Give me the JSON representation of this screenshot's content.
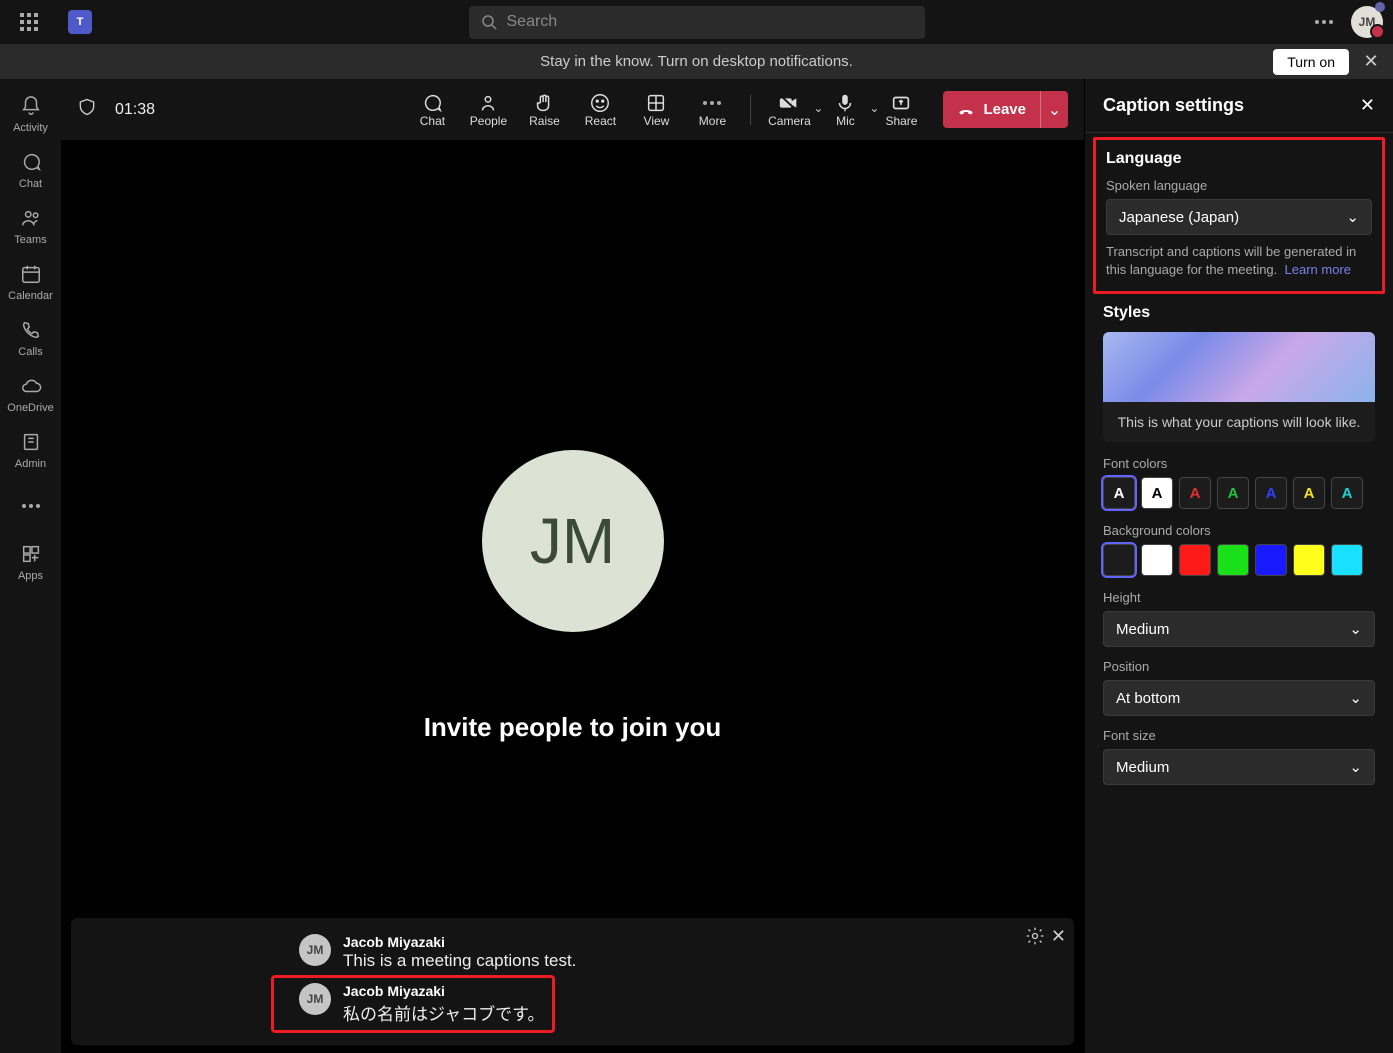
{
  "titlebar": {
    "search_placeholder": "Search",
    "avatar_initials": "JM"
  },
  "notification": {
    "text": "Stay in the know. Turn on desktop notifications.",
    "button": "Turn on"
  },
  "rail": [
    {
      "label": "Activity"
    },
    {
      "label": "Chat"
    },
    {
      "label": "Teams"
    },
    {
      "label": "Calendar"
    },
    {
      "label": "Calls"
    },
    {
      "label": "OneDrive"
    },
    {
      "label": "Admin"
    },
    {
      "label": ""
    },
    {
      "label": "Apps"
    }
  ],
  "meeting": {
    "timer": "01:38",
    "buttons": [
      "Chat",
      "People",
      "Raise",
      "React",
      "View",
      "More",
      "Camera",
      "Mic",
      "Share"
    ],
    "leave": "Leave",
    "avatar_initials": "JM",
    "invite": "Invite people to join you"
  },
  "captions": [
    {
      "initials": "JM",
      "name": "Jacob Miyazaki",
      "text": "This is a meeting captions test."
    },
    {
      "initials": "JM",
      "name": "Jacob Miyazaki",
      "text": "私の名前はジャコブです。"
    }
  ],
  "panel": {
    "title": "Caption settings",
    "language_section": "Language",
    "spoken_label": "Spoken language",
    "spoken_value": "Japanese (Japan)",
    "help": "Transcript and captions will be generated in this language for the meeting.",
    "learn_more": "Learn more",
    "styles_section": "Styles",
    "preview_text": "This is what your captions will look like.",
    "font_colors_label": "Font colors",
    "bg_colors_label": "Background colors",
    "height_label": "Height",
    "height_value": "Medium",
    "position_label": "Position",
    "position_value": "At bottom",
    "fontsize_label": "Font size",
    "fontsize_value": "Medium"
  }
}
